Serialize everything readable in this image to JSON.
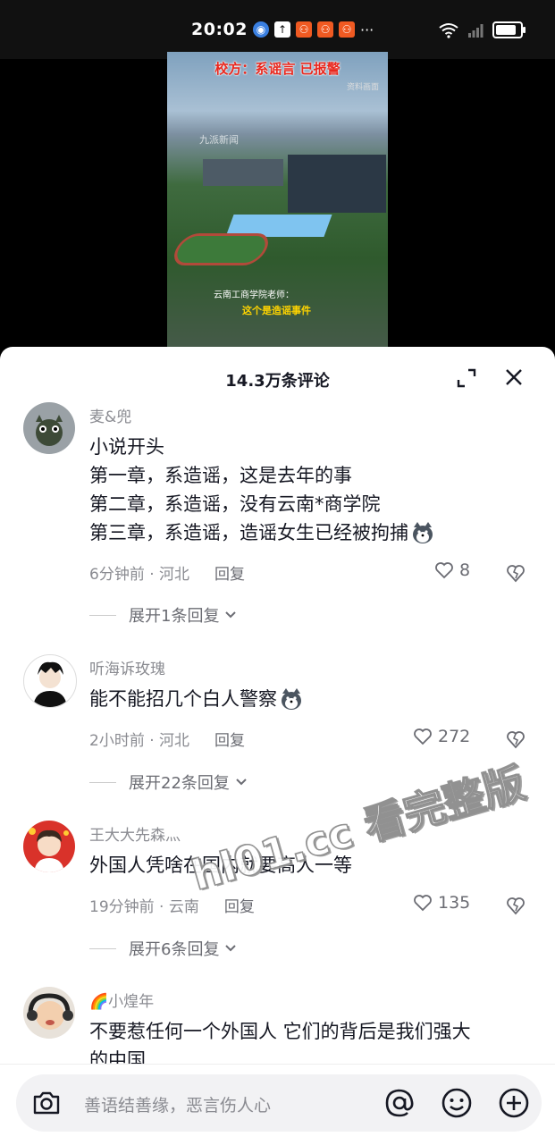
{
  "status_bar": {
    "time": "20:02",
    "more": "···"
  },
  "video": {
    "headline": "校方：系谣言 已报警",
    "source_tag": "资料画面",
    "watermark_logo": "九派新闻",
    "caption_line1": "云南工商学院老师：",
    "caption_line2": "这个是造谣事件"
  },
  "sheet": {
    "title": "14.3万条评论"
  },
  "comments": [
    {
      "name": "麦&兜",
      "lines": [
        "小说开头",
        "第一章，系造谣，这是去年的事",
        "第二章，系造谣，没有云南*商学院",
        "第三章，系造谣，造谣女生已经被拘捕"
      ],
      "time_loc": "6分钟前 · 河北",
      "reply": "回复",
      "likes": "8",
      "expand": "展开1条回复"
    },
    {
      "name": "听海诉玫瑰",
      "lines": [
        "能不能招几个白人警察"
      ],
      "time_loc": "2小时前 · 河北",
      "reply": "回复",
      "likes": "272",
      "expand": "展开22条回复"
    },
    {
      "name": "王大大先森灬",
      "lines": [
        "外国人凭啥在国内就要高人一等"
      ],
      "time_loc": "19分钟前 · 云南",
      "reply": "回复",
      "likes": "135",
      "expand": "展开6条回复"
    },
    {
      "name": "🌈小煌年",
      "lines": [
        "不要惹任何一个外国人 它们的背后是我们强大",
        "的中国"
      ]
    }
  ],
  "overlay_watermark": "hl01.cc 看完整版",
  "input": {
    "placeholder": "善语结善缘，恶言伤人心"
  },
  "colors": {
    "text_primary": "#161823",
    "text_secondary": "#8a8b91",
    "sheet_bg": "#ffffff",
    "input_bg": "#f2f2f4"
  }
}
